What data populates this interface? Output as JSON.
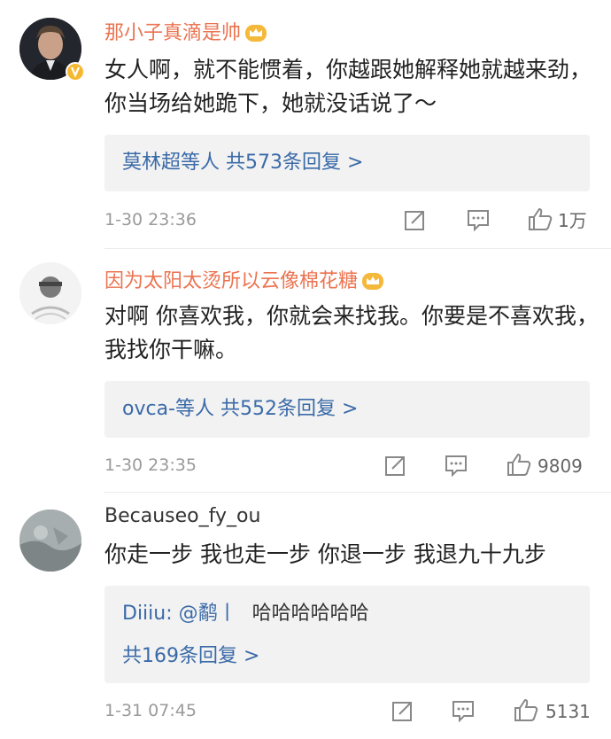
{
  "comments": [
    {
      "username": "那小子真滴是帅",
      "vip_badge": "crown-icon",
      "verified_badge": "verified-icon",
      "text": "女人啊，就不能惯着，你越跟她解释她就越来劲，你当场给她跪下，她就没话说了～",
      "replies_summary": "莫林超等人  共573条回复 >",
      "time": "1-30 23:36",
      "likes": "1万"
    },
    {
      "username": "因为太阳太烫所以云像棉花糖",
      "vip_badge": "crown-icon",
      "text": "对啊 你喜欢我，你就会来找我。你要是不喜欢我，我找你干嘛。",
      "replies_summary": "ovca-等人  共552条回复 >",
      "time": "1-30 23:35",
      "likes": "9809"
    },
    {
      "username": "Becauseo_fy_ou",
      "text": "你走一步 我也走一步 你退一步 我退九十九步",
      "reply_preview_user": "Diiiu: @鹬丨",
      "reply_preview_text": "哈哈哈哈哈哈",
      "replies_summary": "共169条回复 >",
      "time": "1-31 07:45",
      "likes": "5131"
    }
  ],
  "colors": {
    "username": "#eb7350",
    "reply_link": "#3a6aa8",
    "meta": "#9a9a9a",
    "reply_bg": "#f2f2f2"
  }
}
